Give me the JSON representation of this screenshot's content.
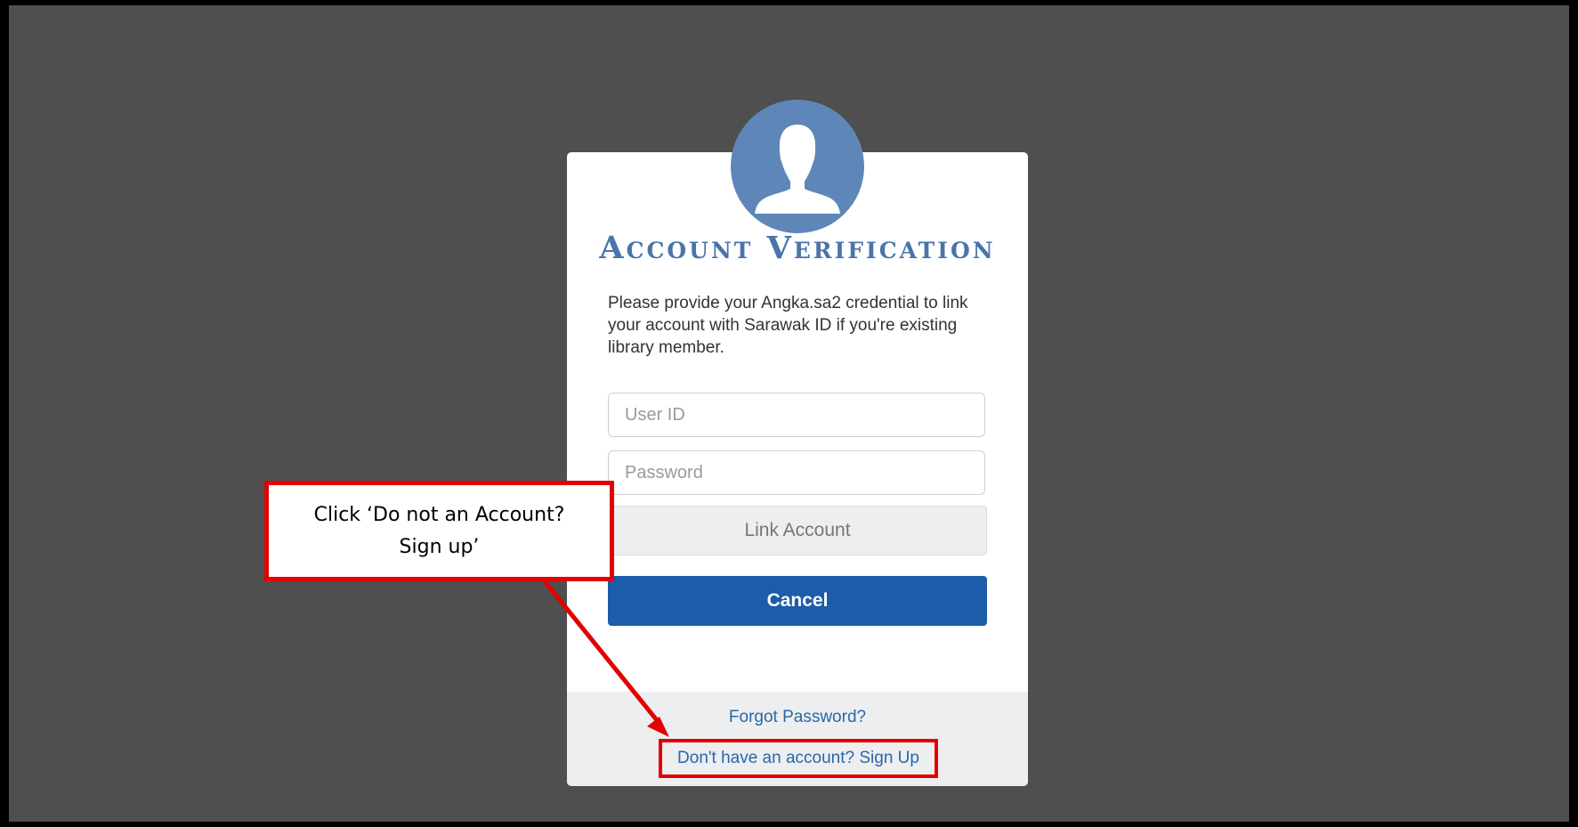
{
  "dialog": {
    "title": "Account Verification",
    "description": "Please provide your Angka.sa2 credential to link your account with Sarawak ID if you're existing library member.",
    "user_id_placeholder": "User ID",
    "password_placeholder": "Password",
    "link_account_label": "Link Account",
    "cancel_label": "Cancel",
    "forgot_password_label": "Forgot Password?",
    "signup_label": "Don't have an account?  Sign Up",
    "avatar_icon": "user-silhouette-icon"
  },
  "annotation": {
    "callout_line1": "Click ‘Do not an Account?",
    "callout_line2": "Sign up’",
    "highlight_color": "#e30000"
  },
  "colors": {
    "background": "#4f4f4f",
    "accent": "#1c5ca8",
    "title": "#4a74aa",
    "link": "#2a67a8"
  }
}
